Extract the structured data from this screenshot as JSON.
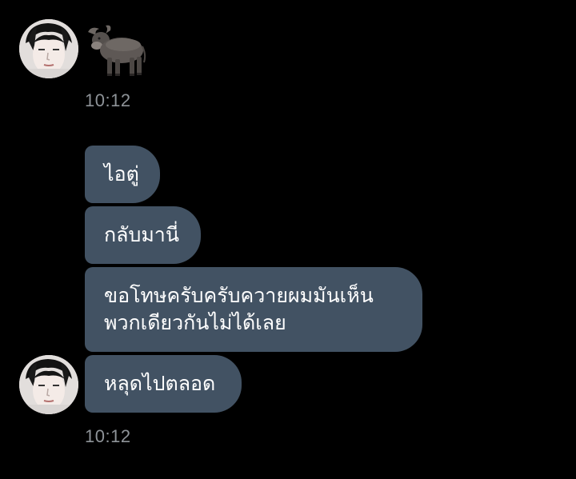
{
  "chat": {
    "first_group": {
      "emoji": "water-buffer-emoji",
      "time": "10:12"
    },
    "second_group": {
      "messages": [
        "ไอตู่",
        "กลับมานี่",
        "ขอโทษครับครับควายผมมันเห็น\nพวกเดียวกันไม่ได้เลย",
        "หลุดไปตลอด"
      ],
      "time": "10:12"
    },
    "colors": {
      "background": "#000000",
      "bubble": "#425263",
      "bubble_text": "#ffffff",
      "timestamp": "#8e9398"
    }
  }
}
